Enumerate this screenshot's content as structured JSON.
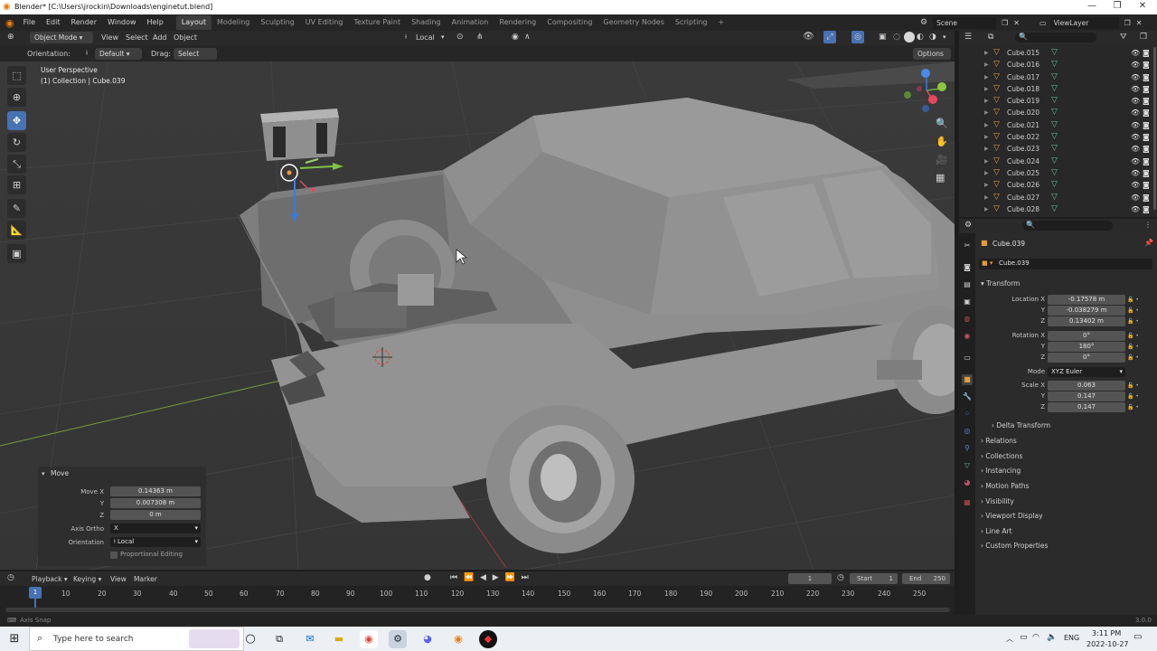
{
  "window": {
    "title": "Blender* [C:\\Users\\jrockin\\Downloads\\enginetut.blend]",
    "controls": [
      "—",
      "❐",
      "✕"
    ]
  },
  "topbar": {
    "menus": [
      "File",
      "Edit",
      "Render",
      "Window",
      "Help"
    ],
    "workspaces": [
      "Layout",
      "Modeling",
      "Sculpting",
      "UV Editing",
      "Texture Paint",
      "Shading",
      "Animation",
      "Rendering",
      "Compositing",
      "Geometry Nodes",
      "Scripting"
    ],
    "active_workspace": "Layout",
    "add_tab": "+",
    "scene": "Scene",
    "view_layer": "ViewLayer"
  },
  "viewport_header": {
    "mode": "Object Mode",
    "menus": [
      "View",
      "Select",
      "Add",
      "Object"
    ],
    "transform_orientation": "Local",
    "orientation_label": "Orientation:",
    "orientation_value": "Default",
    "drag_label": "Drag:",
    "drag_value": "Select Box",
    "options": "Options"
  },
  "viewport": {
    "perspective": "User Perspective",
    "collection": "(1) Collection | Cube.039"
  },
  "move_panel": {
    "title": "Move",
    "move_x_label": "Move X",
    "move_x": "0.14363 m",
    "y_label": "Y",
    "y": "0.007308 m",
    "z_label": "Z",
    "z": "0 m",
    "axis_ortho_label": "Axis Ortho",
    "axis_ortho": "X",
    "orientation_label": "Orientation",
    "orientation": "Local",
    "proportional": "Proportional Editing"
  },
  "outliner": {
    "items": [
      "Cube.015",
      "Cube.016",
      "Cube.017",
      "Cube.018",
      "Cube.019",
      "Cube.020",
      "Cube.021",
      "Cube.022",
      "Cube.023",
      "Cube.024",
      "Cube.025",
      "Cube.026",
      "Cube.027",
      "Cube.028"
    ]
  },
  "properties": {
    "object_name": "Cube.039",
    "data_name": "Cube.039",
    "transform": "Transform",
    "location_label": "Location X",
    "location_x": "-0.17578 m",
    "location_y": "-0.038279 m",
    "location_z": "0.13402 m",
    "rotation_label": "Rotation X",
    "rotation_x": "0°",
    "rotation_y": "180°",
    "rotation_z": "0°",
    "mode_label": "Mode",
    "mode": "XYZ Euler",
    "scale_label": "Scale X",
    "scale_x": "0.063",
    "scale_y": "0.147",
    "scale_z": "0.147",
    "y_label": "Y",
    "z_label": "Z",
    "sections": [
      "Delta Transform",
      "Relations",
      "Collections",
      "Instancing",
      "Motion Paths",
      "Visibility",
      "Viewport Display",
      "Line Art",
      "Custom Properties"
    ]
  },
  "timeline": {
    "menus": [
      "Playback",
      "Keying",
      "View",
      "Marker"
    ],
    "current_frame": "1",
    "start_label": "Start",
    "start": "1",
    "end_label": "End",
    "end": "250",
    "ticks": [
      "1",
      "10",
      "20",
      "30",
      "40",
      "50",
      "60",
      "70",
      "80",
      "90",
      "100",
      "110",
      "120",
      "130",
      "140",
      "150",
      "160",
      "170",
      "180",
      "190",
      "200",
      "210",
      "220",
      "230",
      "240",
      "250"
    ]
  },
  "status": {
    "left": "Axis Snap",
    "version": "3.0.0"
  },
  "taskbar": {
    "search_placeholder": "Type here to search",
    "time": "3:11 PM",
    "date": "2022-10-27",
    "lang": "ENG"
  }
}
